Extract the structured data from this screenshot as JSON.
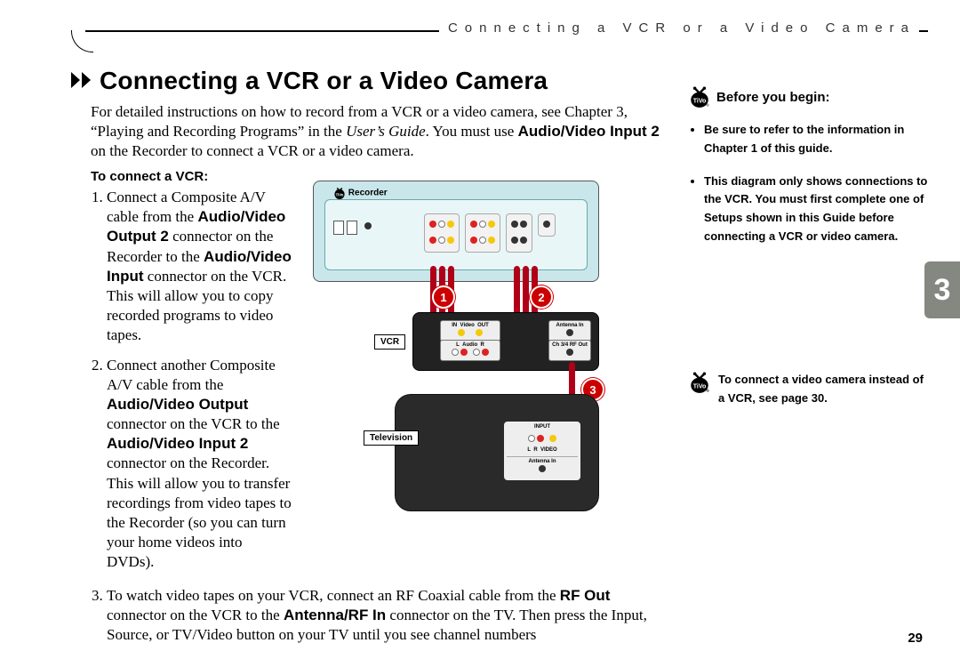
{
  "header": {
    "running_title": "Connecting a VCR or a Video Camera"
  },
  "title": "Connecting a VCR or a Video Camera",
  "intro_parts": {
    "p1": "For detailed instructions on how to record from a VCR or a video camera, see Chapter 3, “Playing and Recording Programs” in the ",
    "em": "User’s Guide",
    "p2": ". You must use ",
    "b1": "Audio/Video Input 2",
    "p3": " on the Recorder to connect a VCR or a video camera."
  },
  "subhead_vcr": "To connect a VCR:",
  "steps": {
    "s1": {
      "a": "Connect a Composite A/V cable from the ",
      "b1": "Audio/Video Output 2",
      "b": " connector on the Recorder to the ",
      "b2": "Audio/Video Input",
      "c": " connector on the VCR. This will allow you to copy recorded programs to video tapes."
    },
    "s2": {
      "a": "Connect another Composite A/V cable from the ",
      "b1": "Audio/Video Output",
      "b": " connector on the VCR to the ",
      "b2": "Audio/Video Input 2",
      "c": " connector on the Recorder. This will allow you to transfer recordings from video tapes to the Recorder (so you can turn your home videos into DVDs)."
    },
    "s3": {
      "a": "To watch video tapes on your VCR, connect an RF Coaxial cable from the ",
      "b1": "RF Out",
      "b": " connector on the VCR to the ",
      "b2": "Antenna/RF In",
      "c": " connector on the TV. Then press the Input, Source, or TV/Video button on your TV until you see channel numbers"
    }
  },
  "figure": {
    "labels": {
      "recorder": "Recorder",
      "vcr": "VCR",
      "television": "Television",
      "vcr_in": "IN",
      "vcr_out": "OUT",
      "vcr_video": "Video",
      "vcr_audio": "Audio",
      "vcr_l": "L",
      "vcr_r": "R",
      "antenna_in": "Antenna In",
      "ch34": "Ch 3/4",
      "rf_out": "RF Out",
      "tv_input": "INPUT",
      "tv_video": "VIDEO",
      "tv_l": "L",
      "tv_r": "R",
      "tv_antenna": "Antenna In"
    },
    "callouts": {
      "c1": "1",
      "c2": "2",
      "c3": "3"
    }
  },
  "sidebar": {
    "before": "Before you begin:",
    "bullets": [
      "Be sure to refer to the information in Chapter 1 of this guide.",
      "This diagram only shows connections to the VCR. You must first complete one of Setups shown in this Guide before connecting a VCR or video camera."
    ],
    "note2": "To connect a video camera instead of a VCR, see page 30."
  },
  "thumb": "3",
  "page_number": "29"
}
